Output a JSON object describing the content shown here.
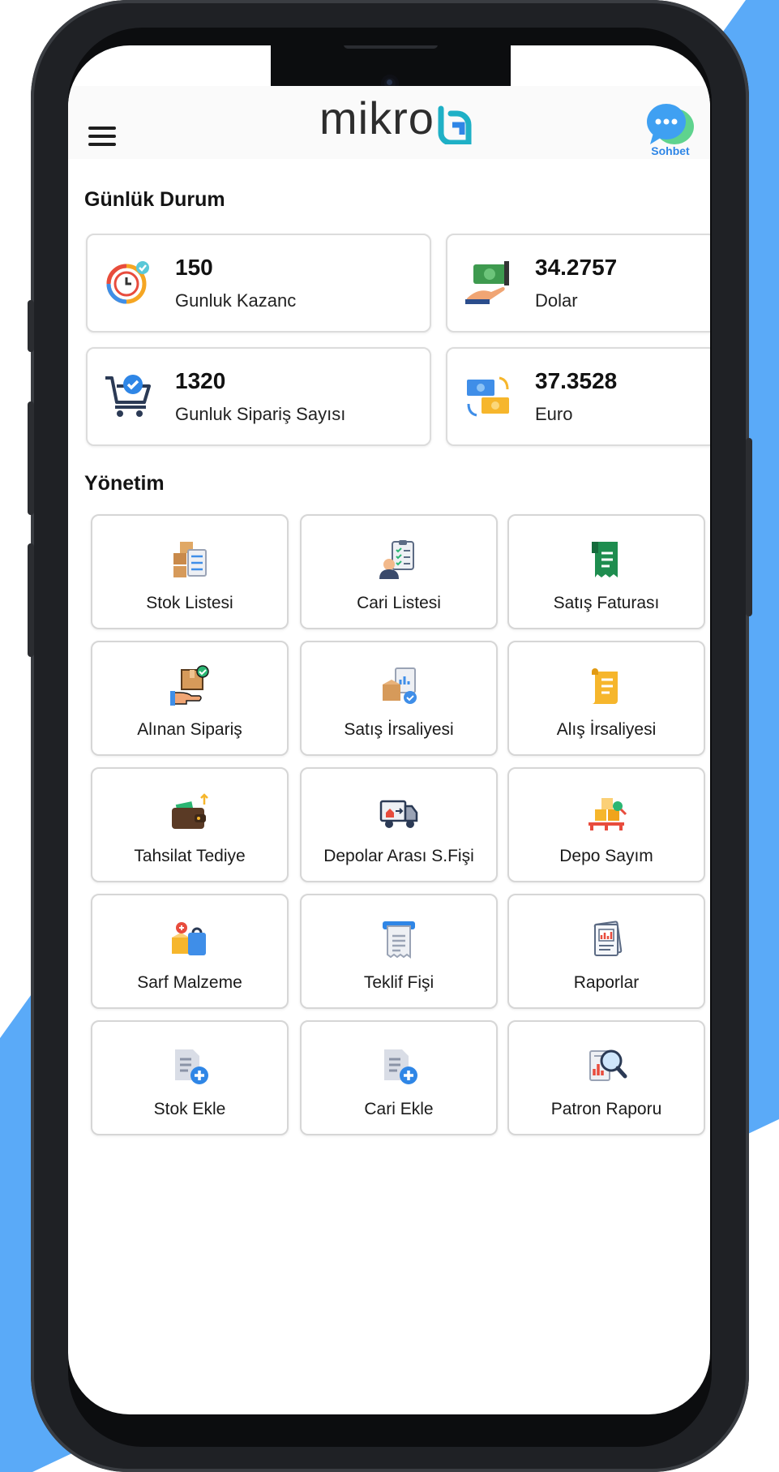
{
  "colors": {
    "accent_blue": "#5aaaf8",
    "brand_teal": "#1fb0c6",
    "chat_blue": "#2f86e6",
    "phone_frame": "#1f2125"
  },
  "header": {
    "logo_text": "mikro",
    "chat_label": "Sohbet",
    "menu_icon": "hamburger-menu-icon",
    "chat_icon": "chat-bubble-icon"
  },
  "daily": {
    "title": "Günlük Durum",
    "cards": [
      {
        "value": "150",
        "label": "Gunluk Kazanc",
        "icon": "clock-earnings-icon"
      },
      {
        "value": "34.2757",
        "label": "Dolar",
        "icon": "dollar-cash-icon"
      },
      {
        "value": "1320",
        "label": "Gunluk Sipariş Sayısı",
        "icon": "shopping-cart-icon"
      },
      {
        "value": "37.3528",
        "label": "Euro",
        "icon": "euro-exchange-icon"
      }
    ]
  },
  "management": {
    "title": "Yönetim",
    "items": [
      {
        "label": "Stok Listesi",
        "icon": "stock-list-icon"
      },
      {
        "label": "Cari Listesi",
        "icon": "account-list-icon"
      },
      {
        "label": "Satış Faturası",
        "icon": "sales-invoice-icon"
      },
      {
        "label": "Alınan Sipariş",
        "icon": "received-order-icon"
      },
      {
        "label": "Satış İrsaliyesi",
        "icon": "sales-waybill-icon"
      },
      {
        "label": "Alış İrsaliyesi",
        "icon": "purchase-waybill-icon"
      },
      {
        "label": "Tahsilat Tediye",
        "icon": "wallet-icon"
      },
      {
        "label": "Depolar Arası S.Fişi",
        "icon": "delivery-truck-icon"
      },
      {
        "label": "Depo Sayım",
        "icon": "warehouse-count-icon"
      },
      {
        "label": "Sarf Malzeme",
        "icon": "consumables-icon"
      },
      {
        "label": "Teklif Fişi",
        "icon": "receipt-icon"
      },
      {
        "label": "Raporlar",
        "icon": "reports-icon"
      },
      {
        "label": "Stok Ekle",
        "icon": "add-stock-icon"
      },
      {
        "label": "Cari Ekle",
        "icon": "add-account-icon"
      },
      {
        "label": "Patron Raporu",
        "icon": "boss-report-icon"
      }
    ]
  }
}
